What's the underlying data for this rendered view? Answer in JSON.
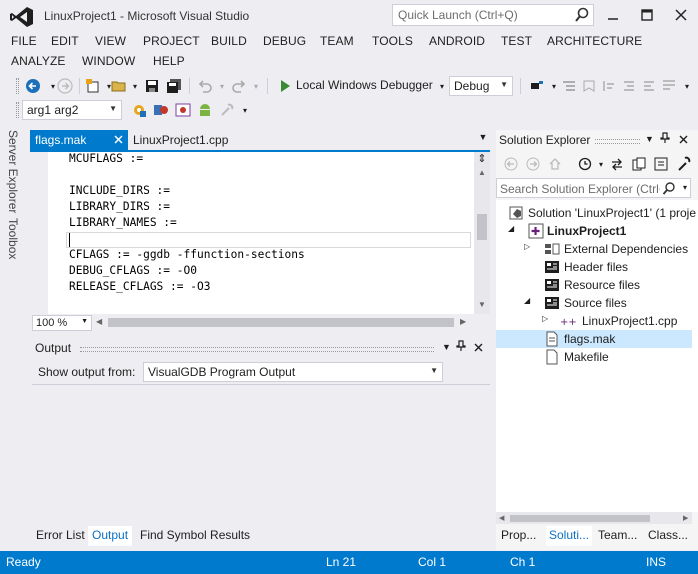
{
  "window": {
    "title": "LinuxProject1 - Microsoft Visual Studio",
    "quick_launch_placeholder": "Quick Launch (Ctrl+Q)"
  },
  "menu": {
    "row1": [
      "FILE",
      "EDIT",
      "VIEW",
      "PROJECT",
      "BUILD",
      "DEBUG",
      "TEAM",
      "TOOLS",
      "ANDROID",
      "TEST",
      "ARCHITECTURE"
    ],
    "row2": [
      "ANALYZE",
      "WINDOW",
      "HELP"
    ]
  },
  "toolbar": {
    "debugger_label": "Local Windows Debugger",
    "config_value": "Debug",
    "args_value": "arg1 arg2"
  },
  "side_tabs": [
    "Server Explorer",
    "Toolbox"
  ],
  "editor": {
    "tabs": [
      {
        "label": "flags.mak",
        "active": true
      },
      {
        "label": "LinuxProject1.cpp",
        "active": false
      }
    ],
    "lines": [
      "MCUFLAGS :=",
      "",
      "INCLUDE_DIRS :=",
      "LIBRARY_DIRS :=",
      "LIBRARY_NAMES :=",
      "",
      "CFLAGS := -ggdb -ffunction-sections",
      "DEBUG_CFLAGS := -O0",
      "RELEASE_CFLAGS := -O3"
    ],
    "zoom": "100 %",
    "current_line": 21
  },
  "output": {
    "title": "Output",
    "show_from_label": "Show output from:",
    "source_value": "VisualGDB Program Output"
  },
  "bottom_tabs": [
    {
      "label": "Error List",
      "active": false
    },
    {
      "label": "Output",
      "active": true
    },
    {
      "label": "Find Symbol Results",
      "active": false
    }
  ],
  "solution_explorer": {
    "title": "Solution Explorer",
    "search_placeholder": "Search Solution Explorer (Ctrl+",
    "tree": [
      {
        "label": "Solution 'LinuxProject1' (1 proje",
        "level": 0,
        "expander": "",
        "icon": "solution-icon",
        "bold": false
      },
      {
        "label": "LinuxProject1",
        "level": 1,
        "expander": "◢",
        "icon": "project-icon",
        "bold": true
      },
      {
        "label": "External Dependencies",
        "level": 2,
        "expander": "▷",
        "icon": "external-deps-icon",
        "bold": false
      },
      {
        "label": "Header files",
        "level": 2,
        "expander": "",
        "icon": "folder-filter-icon",
        "bold": false
      },
      {
        "label": "Resource files",
        "level": 2,
        "expander": "",
        "icon": "folder-filter-icon",
        "bold": false
      },
      {
        "label": "Source files",
        "level": 2,
        "expander": "◢",
        "icon": "folder-filter-icon",
        "bold": false
      },
      {
        "label": "LinuxProject1.cpp",
        "level": 3,
        "expander": "▷",
        "icon": "cpp-file-icon",
        "bold": false
      },
      {
        "label": "flags.mak",
        "level": 2,
        "expander": "",
        "icon": "file-icon",
        "bold": false,
        "selected": true
      },
      {
        "label": "Makefile",
        "level": 2,
        "expander": "",
        "icon": "file-icon",
        "bold": false
      }
    ],
    "tabs": [
      {
        "label": "Prop...",
        "active": false
      },
      {
        "label": "Soluti...",
        "active": true
      },
      {
        "label": "Team...",
        "active": false
      },
      {
        "label": "Class...",
        "active": false
      }
    ]
  },
  "statusbar": {
    "state": "Ready",
    "line": "Ln 21",
    "col": "Col 1",
    "ch": "Ch 1",
    "mode": "INS"
  },
  "colors": {
    "accent": "#007acc",
    "chrome": "#eeeef2",
    "selection": "#cce8ff"
  }
}
